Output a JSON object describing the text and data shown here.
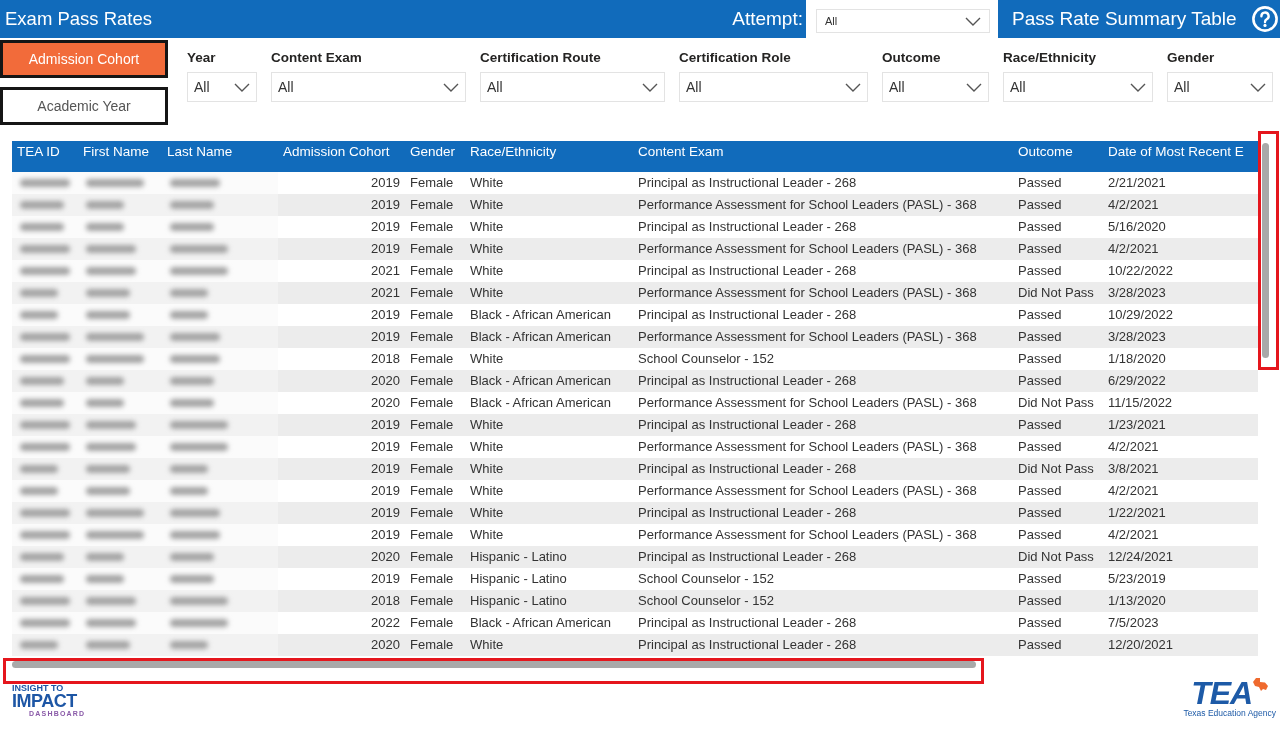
{
  "header": {
    "title": "Exam Pass Rates",
    "attempt": {
      "label": "Attempt:",
      "value": "All"
    },
    "summary_button": "Pass Rate Summary Table"
  },
  "view_toggle": [
    {
      "label": "Admission Cohort",
      "selected": true
    },
    {
      "label": "Academic Year",
      "selected": false
    }
  ],
  "filters": [
    {
      "label": "Year",
      "value": "All"
    },
    {
      "label": "Content Exam",
      "value": "All"
    },
    {
      "label": "Certification Route",
      "value": "All"
    },
    {
      "label": "Certification Role",
      "value": "All"
    },
    {
      "label": "Outcome",
      "value": "All"
    },
    {
      "label": "Race/Ethnicity",
      "value": "All"
    },
    {
      "label": "Gender",
      "value": "All"
    }
  ],
  "table": {
    "columns": [
      {
        "label": "TEA ID",
        "kind": "blurred"
      },
      {
        "label": "First Name",
        "kind": "blurred"
      },
      {
        "label": "Last Name",
        "kind": "blurred"
      },
      {
        "label": "Admission Cohort",
        "kind": "number"
      },
      {
        "label": "Gender",
        "kind": "text"
      },
      {
        "label": "Race/Ethnicity",
        "kind": "text"
      },
      {
        "label": "Content Exam",
        "kind": "text"
      },
      {
        "label": "Outcome",
        "kind": "text"
      },
      {
        "label": "Date of Most Recent E",
        "kind": "text"
      }
    ],
    "rows": [
      {
        "cells": [
          "",
          "",
          "",
          "2019",
          "Female",
          "White",
          "Principal as Instructional Leader - 268",
          "Passed",
          "2/21/2021"
        ]
      },
      {
        "cells": [
          "",
          "",
          "",
          "2019",
          "Female",
          "White",
          "Performance Assessment for School Leaders (PASL) - 368",
          "Passed",
          "4/2/2021"
        ]
      },
      {
        "cells": [
          "",
          "",
          "",
          "2019",
          "Female",
          "White",
          "Principal as Instructional Leader - 268",
          "Passed",
          "5/16/2020"
        ]
      },
      {
        "cells": [
          "",
          "",
          "",
          "2019",
          "Female",
          "White",
          "Performance Assessment for School Leaders (PASL) - 368",
          "Passed",
          "4/2/2021"
        ]
      },
      {
        "cells": [
          "",
          "",
          "",
          "2021",
          "Female",
          "White",
          "Principal as Instructional Leader - 268",
          "Passed",
          "10/22/2022"
        ]
      },
      {
        "cells": [
          "",
          "",
          "",
          "2021",
          "Female",
          "White",
          "Performance Assessment for School Leaders (PASL) - 368",
          "Did Not Pass",
          "3/28/2023"
        ]
      },
      {
        "cells": [
          "",
          "",
          "",
          "2019",
          "Female",
          "Black - African American",
          "Principal as Instructional Leader - 268",
          "Passed",
          "10/29/2022"
        ]
      },
      {
        "cells": [
          "",
          "",
          "",
          "2019",
          "Female",
          "Black - African American",
          "Performance Assessment for School Leaders (PASL) - 368",
          "Passed",
          "3/28/2023"
        ]
      },
      {
        "cells": [
          "",
          "",
          "",
          "2018",
          "Female",
          "White",
          "School Counselor - 152",
          "Passed",
          "1/18/2020"
        ]
      },
      {
        "cells": [
          "",
          "",
          "",
          "2020",
          "Female",
          "Black - African American",
          "Principal as Instructional Leader - 268",
          "Passed",
          "6/29/2022"
        ]
      },
      {
        "cells": [
          "",
          "",
          "",
          "2020",
          "Female",
          "Black - African American",
          "Performance Assessment for School Leaders (PASL) - 368",
          "Did Not Pass",
          "11/15/2022"
        ]
      },
      {
        "cells": [
          "",
          "",
          "",
          "2019",
          "Female",
          "White",
          "Principal as Instructional Leader - 268",
          "Passed",
          "1/23/2021"
        ]
      },
      {
        "cells": [
          "",
          "",
          "",
          "2019",
          "Female",
          "White",
          "Performance Assessment for School Leaders (PASL) - 368",
          "Passed",
          "4/2/2021"
        ]
      },
      {
        "cells": [
          "",
          "",
          "",
          "2019",
          "Female",
          "White",
          "Principal as Instructional Leader - 268",
          "Did Not Pass",
          "3/8/2021"
        ]
      },
      {
        "cells": [
          "",
          "",
          "",
          "2019",
          "Female",
          "White",
          "Performance Assessment for School Leaders (PASL) - 368",
          "Passed",
          "4/2/2021"
        ]
      },
      {
        "cells": [
          "",
          "",
          "",
          "2019",
          "Female",
          "White",
          "Principal as Instructional Leader - 268",
          "Passed",
          "1/22/2021"
        ]
      },
      {
        "cells": [
          "",
          "",
          "",
          "2019",
          "Female",
          "White",
          "Performance Assessment for School Leaders (PASL) - 368",
          "Passed",
          "4/2/2021"
        ]
      },
      {
        "cells": [
          "",
          "",
          "",
          "2020",
          "Female",
          "Hispanic - Latino",
          "Principal as Instructional Leader - 268",
          "Did Not Pass",
          "12/24/2021"
        ]
      },
      {
        "cells": [
          "",
          "",
          "",
          "2019",
          "Female",
          "Hispanic - Latino",
          "School Counselor - 152",
          "Passed",
          "5/23/2019"
        ]
      },
      {
        "cells": [
          "",
          "",
          "",
          "2018",
          "Female",
          "Hispanic - Latino",
          "School Counselor - 152",
          "Passed",
          "1/13/2020"
        ]
      },
      {
        "cells": [
          "",
          "",
          "",
          "2022",
          "Female",
          "Black - African American",
          "Principal as Instructional Leader - 268",
          "Passed",
          "7/5/2023"
        ]
      },
      {
        "cells": [
          "",
          "",
          "",
          "2020",
          "Female",
          "White",
          "Principal as Instructional Leader - 268",
          "Passed",
          "12/20/2021"
        ]
      }
    ],
    "vertical_scrollbar": {
      "highlighted": true
    },
    "horizontal_scrollbar": {
      "highlighted": true
    }
  },
  "footer": {
    "dashboard_logo": [
      "INSIGHT TO",
      "IMPACT",
      "DASHBOARD"
    ],
    "agency_logo": {
      "wordmark": "TEA",
      "subtitle": "Texas Education Agency"
    }
  }
}
